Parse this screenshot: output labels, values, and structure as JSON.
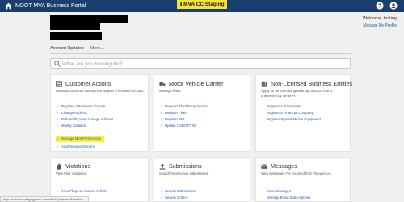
{
  "header": {
    "title": "MDOT MVA Business Portal",
    "environment_badge": "MVA CC Staging",
    "icons": [
      "home-icon",
      "help-icon",
      "account-icon"
    ]
  },
  "user": {
    "welcome": "Welcome, testing",
    "profile_link": "Manage My Profile"
  },
  "tabs": [
    {
      "label": "Account Updates",
      "active": true
    },
    {
      "label": "More...",
      "active": false
    }
  ],
  "search": {
    "placeholder": "What are you looking for?"
  },
  "cards": [
    {
      "title": "Customer Actions",
      "icon": "person-card-icon",
      "description": "Maintain customer attributes or register a licensed account.",
      "links": [
        "Register a Business License",
        "Change Address",
        "Bulk Add/Update Garage Address",
        "Modify Contacts",
        "Manage Mail Preferences",
        "Add/Remove Owners"
      ],
      "highlighted_link": "Manage Mail Preferences"
    },
    {
      "title": "Motor Vehicle Carrier",
      "icon": "truck-icon",
      "description": "Manage fleets.",
      "links": [
        "Request Third Party Access",
        "Register Fleet",
        "Register IRP",
        "Update USDOT/TIN"
      ]
    },
    {
      "title": "Non-Licensed Business Entities",
      "icon": "building-icon",
      "description": "Apply for an interchangeable tag account that is unlicensed by the MVA.",
      "links": [
        "Register a Transporter",
        "Register a Financial Company",
        "Register Special Mobile Equipment"
      ]
    },
    {
      "title": "Violations",
      "icon": "hand-icon",
      "description": "View Flag Violations.",
      "links": [
        "View Flags on Owned Vehicle"
      ]
    },
    {
      "title": "Submissions",
      "icon": "upload-icon",
      "description": "Search for previous submissions.",
      "links": [
        "Search Submissions",
        "Search Orders"
      ]
    },
    {
      "title": "Messages",
      "icon": "envelope-icon",
      "description": "View messages I've received from the agency...",
      "links": [
        "View Messages",
        "Manage Email Subscriptions"
      ]
    }
  ],
  "status_bar_url": "https://mdotmva.stagingportal.com/s/MVA_BusinessPortal?id=..."
}
